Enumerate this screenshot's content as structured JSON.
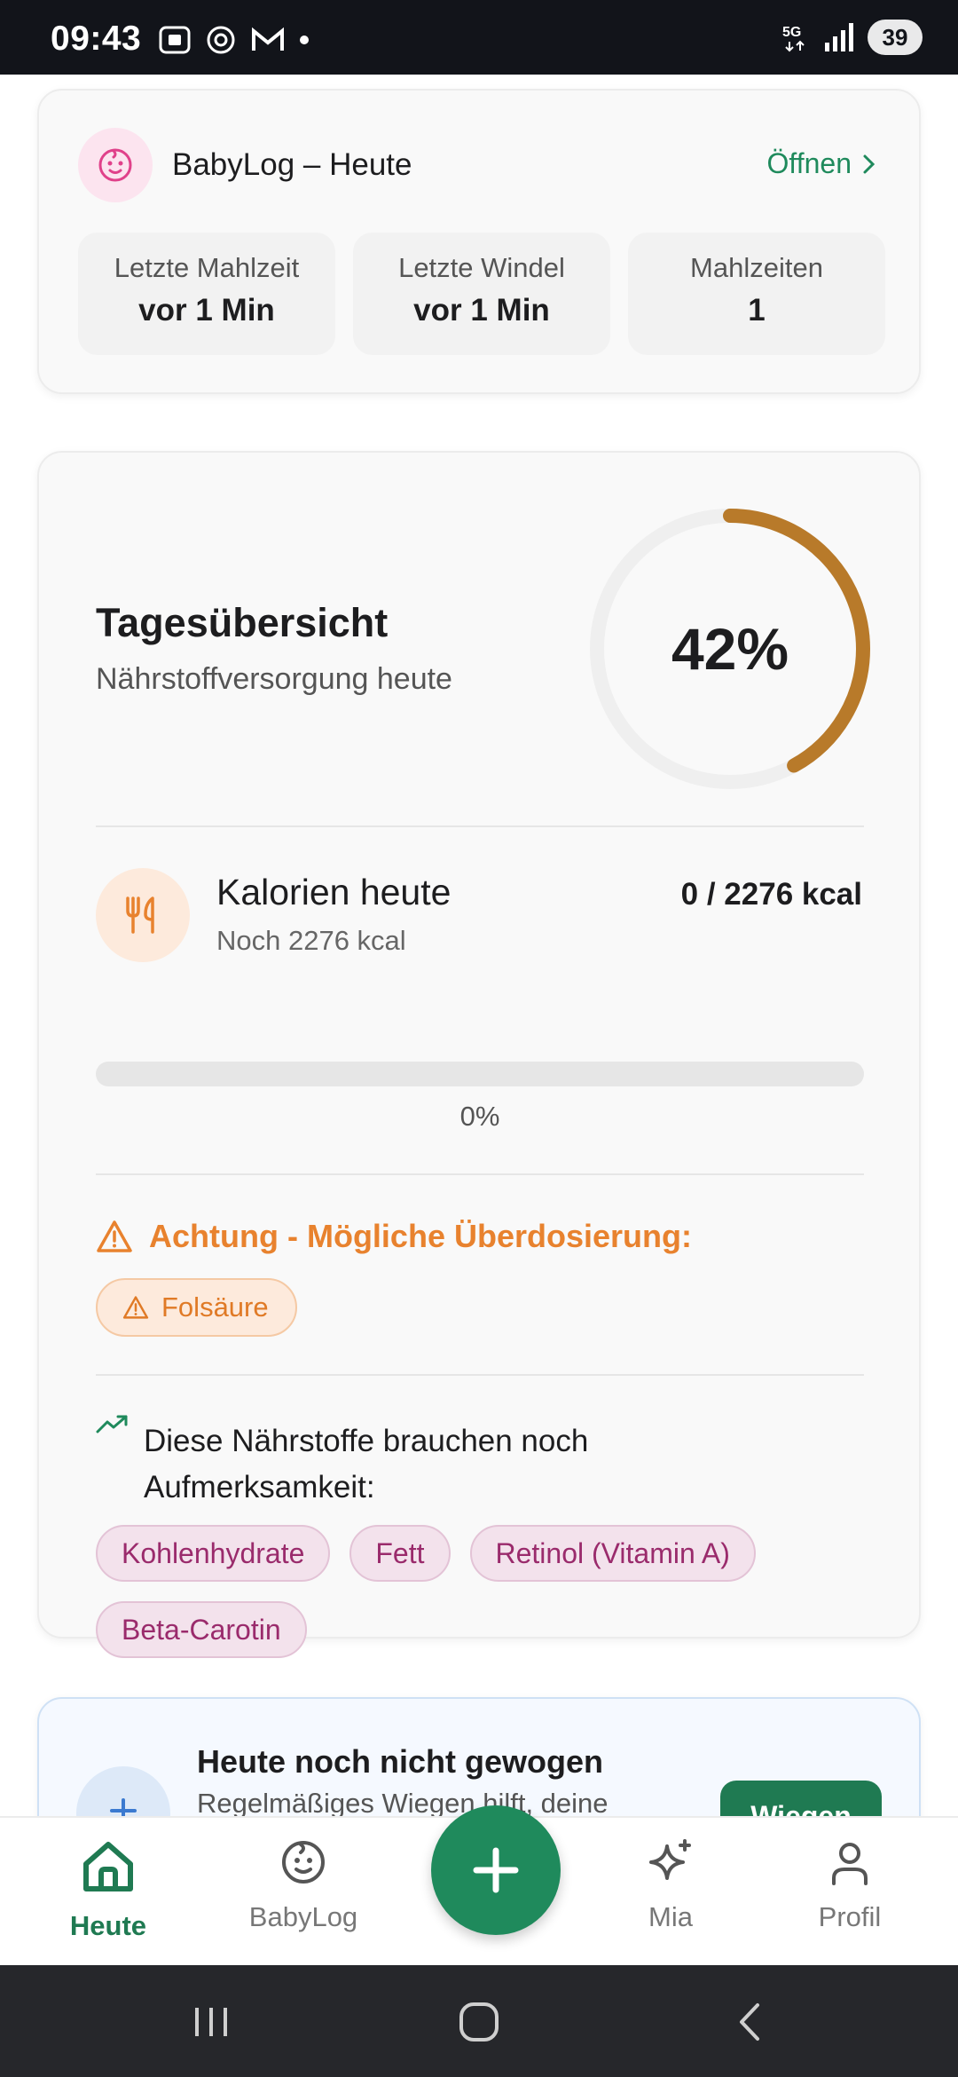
{
  "status_bar": {
    "time": "09:43",
    "network": "5G",
    "battery": "39",
    "icons_left": [
      "screenshot-icon",
      "openai-icon",
      "gmail-icon",
      "dot-icon"
    ],
    "icons_right": [
      "5g-icon",
      "signal-icon",
      "battery-icon"
    ]
  },
  "babylog_card": {
    "title": "BabyLog – Heute",
    "open_label": "Öffnen",
    "stats": [
      {
        "label": "Letzte Mahlzeit",
        "value": "vor 1 Min"
      },
      {
        "label": "Letzte Windel",
        "value": "vor 1 Min"
      },
      {
        "label": "Mahlzeiten",
        "value": "1"
      }
    ]
  },
  "overview": {
    "title": "Tagesübersicht",
    "subtitle": "Nährstoffversorgung heute",
    "percent_label": "42%",
    "percent_value": 0.42,
    "ring_color": "#b87a2a",
    "calories": {
      "title": "Kalorien heute",
      "remaining": "Noch 2276 kcal",
      "value": "0 / 2276 kcal",
      "progress": 0,
      "progress_label": "0%"
    },
    "warning": {
      "title": "Achtung - Mögliche Überdosierung:",
      "chips": [
        "Folsäure"
      ]
    },
    "attention": {
      "title": "Diese Nährstoffe brauchen noch Aufmerksamkeit:",
      "chips": [
        "Kohlenhydrate",
        "Fett",
        "Retinol (Vitamin A)",
        "Beta-Carotin"
      ]
    }
  },
  "weight_card": {
    "title": "Heute noch nicht gewogen",
    "subtitle": "Regelmäßiges Wiegen hilft, deine",
    "button": "Wiegen"
  },
  "bottom_nav": {
    "items": [
      {
        "label": "Heute",
        "icon": "home-icon",
        "active": true
      },
      {
        "label": "BabyLog",
        "icon": "baby-face-icon",
        "active": false
      },
      {
        "label": "Mia",
        "icon": "sparkles-icon",
        "active": false
      },
      {
        "label": "Profil",
        "icon": "person-icon",
        "active": false
      }
    ],
    "fab_icon": "plus-icon"
  },
  "colors": {
    "brand_green": "#1f8a5c",
    "warning_orange": "#e8822e",
    "attention_pink": "#9a2b6c"
  }
}
